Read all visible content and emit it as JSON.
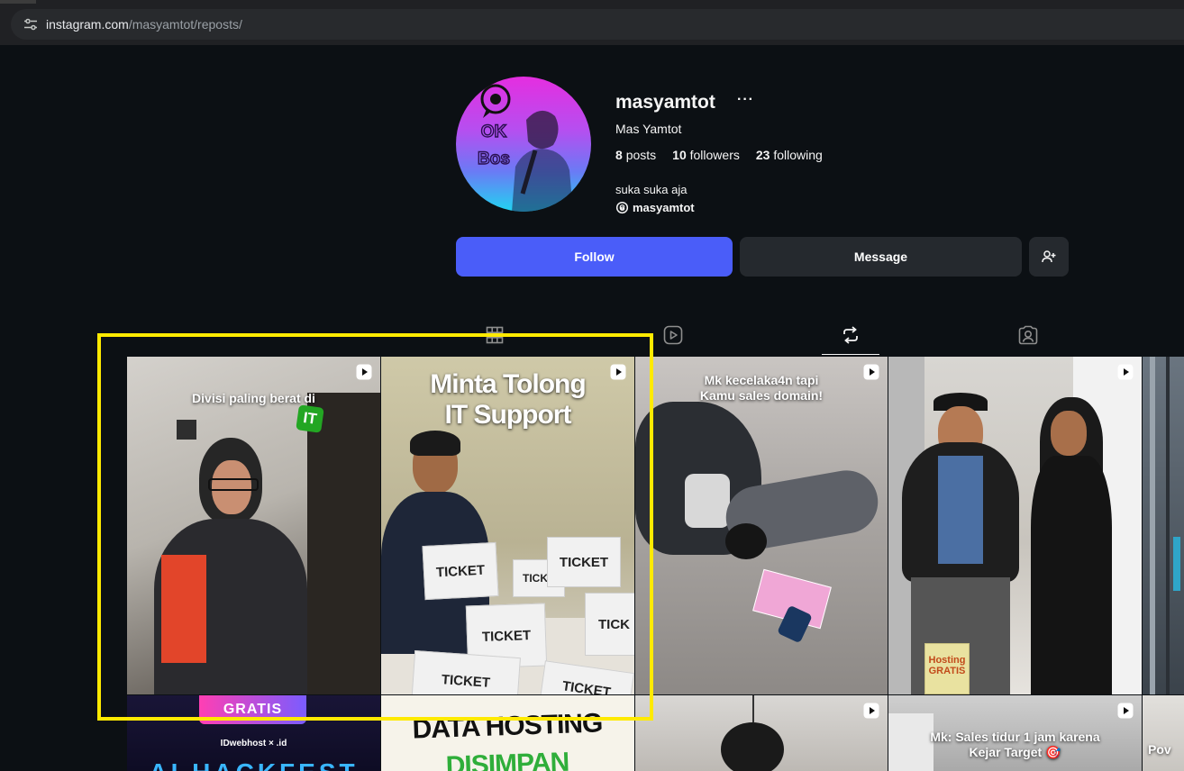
{
  "browser": {
    "url_host": "instagram.com",
    "url_path": "/masyamtot/reposts/",
    "icon": "tune-icon"
  },
  "profile": {
    "username": "masyamtot",
    "more_label": "···",
    "full_name": "Mas Yamtot",
    "avatar_text_1": "OK",
    "avatar_text_2": "Bos",
    "stats": {
      "posts_count": "8",
      "posts_label": "posts",
      "followers_count": "10",
      "followers_label": "followers",
      "following_count": "23",
      "following_label": "following"
    },
    "bio": "suka suka aja",
    "threads_handle": "masyamtot"
  },
  "actions": {
    "follow_label": "Follow",
    "message_label": "Message",
    "add_user_icon": "add-user-icon"
  },
  "tabs": [
    {
      "name": "posts",
      "icon": "grid-icon",
      "active": false
    },
    {
      "name": "reels",
      "icon": "reels-icon",
      "active": false
    },
    {
      "name": "reposts",
      "icon": "repost-icon",
      "active": true
    },
    {
      "name": "tagged",
      "icon": "tagged-icon",
      "active": false
    }
  ],
  "posts": [
    {
      "caption": "Divisi paling berat di",
      "badge": "IT"
    },
    {
      "caption_line1": "Minta Tolong",
      "caption_line2": "IT Support",
      "tickets": [
        "TICKET",
        "TICKE",
        "TICKET",
        "TICKET",
        "TICK",
        "TICKET",
        "TICKET"
      ]
    },
    {
      "caption_line1": "Mk kecelaka4n tapi",
      "caption_line2": "Kamu sales domain!"
    },
    {
      "badge_line1": "Hosting",
      "badge_line2": "GRATIS"
    },
    {
      "caption": ""
    },
    {
      "banner": "GRATIS",
      "brand": "IDwebhost",
      "cross": "×",
      "brand2": ".id",
      "bottom": "AI HACKFEST"
    },
    {
      "caption_line1": "DATA HOSTING",
      "caption_line2": "DISIMPAN"
    },
    {
      "caption": ""
    },
    {
      "caption_line1": "Mk: Sales tidur 1 jam karena",
      "caption_line2": "Kejar Target 🎯"
    },
    {
      "caption": "Pov"
    }
  ],
  "colors": {
    "background": "#0c1014",
    "follow_button": "#4a5df9",
    "secondary_button": "#25292e",
    "highlight": "#ffea00"
  }
}
